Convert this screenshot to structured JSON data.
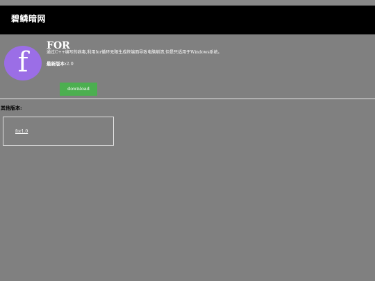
{
  "header": {
    "site_title": "碧鳞暗网"
  },
  "app": {
    "icon_letter": "f",
    "icon_color": "#9b6ee6",
    "name": "FOR",
    "description": "通过C++编写的病毒,利用for循环无限生成终端而导致电脑崩溃,但是只适用于Windows系统。",
    "latest_version_label": "最新版本:",
    "latest_version": "2.0",
    "download_label": "download",
    "download_color": "#4caf50"
  },
  "other_versions": {
    "title": "其他版本:",
    "items": [
      {
        "label": "for1.0"
      }
    ]
  }
}
